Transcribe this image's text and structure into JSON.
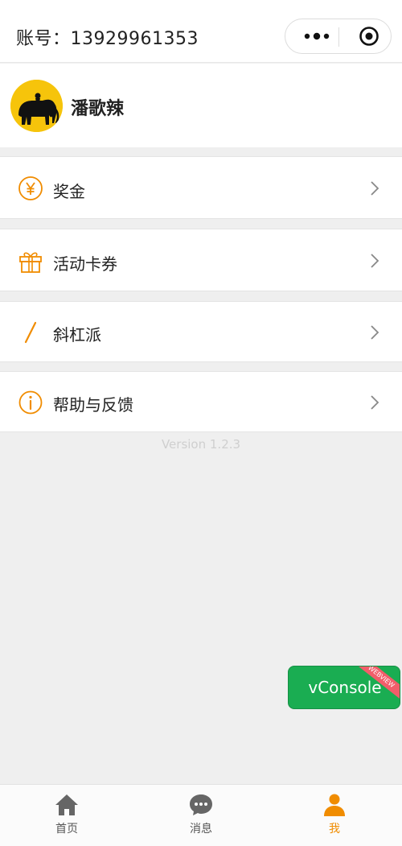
{
  "header": {
    "account_text": "账号：13929961353"
  },
  "capsule": {
    "more_icon": "more-dots-icon",
    "close_icon": "target-circle-icon"
  },
  "profile": {
    "name": "潘歌辣",
    "avatar_icon": "elephant-avatar-icon"
  },
  "menu": {
    "items": [
      {
        "label": "奖金",
        "icon": "yen-circle-icon"
      },
      {
        "label": "活动卡券",
        "icon": "gift-icon"
      },
      {
        "label": "斜杠派",
        "icon": "slash-icon"
      },
      {
        "label": "帮助与反馈",
        "icon": "info-circle-icon"
      }
    ]
  },
  "version": "Version 1.2.3",
  "vconsole": {
    "label": "vConsole",
    "ribbon": "WEBVIEW"
  },
  "tabbar": {
    "tabs": [
      {
        "label": "首页",
        "icon": "home-icon",
        "active": false
      },
      {
        "label": "消息",
        "icon": "chat-bubble-icon",
        "active": false
      },
      {
        "label": "我",
        "icon": "person-icon",
        "active": true
      }
    ]
  },
  "colors": {
    "accent": "#f08c00",
    "vconsole": "#1aad52",
    "avatar_bg": "#f6c40b",
    "background": "#efefef"
  }
}
